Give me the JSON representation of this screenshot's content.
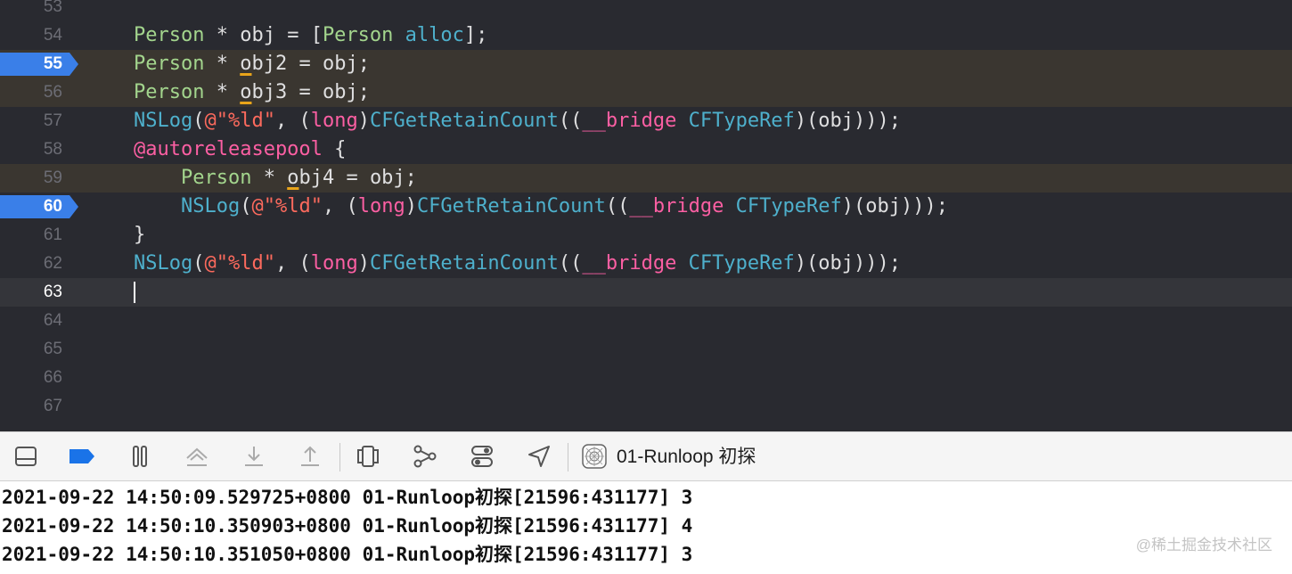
{
  "editor": {
    "lines": [
      {
        "num": "53",
        "tokens": []
      },
      {
        "num": "54",
        "tokens": [
          [
            "t-type",
            "Person"
          ],
          [
            "t-plain",
            " * obj = ["
          ],
          [
            "t-type",
            "Person"
          ],
          [
            "t-plain",
            " "
          ],
          [
            "t-fn",
            "alloc"
          ],
          [
            "t-plain",
            "];"
          ]
        ]
      },
      {
        "num": "55",
        "tokens": [
          [
            "t-type",
            "Person"
          ],
          [
            "t-plain",
            " * "
          ],
          [
            "t-warn",
            "o"
          ],
          [
            "t-plain",
            "bj2 = obj;"
          ]
        ]
      },
      {
        "num": "56",
        "tokens": [
          [
            "t-type",
            "Person"
          ],
          [
            "t-plain",
            " * "
          ],
          [
            "t-warn",
            "o"
          ],
          [
            "t-plain",
            "bj3 = obj;"
          ]
        ]
      },
      {
        "num": "57",
        "tokens": [
          [
            "t-fn",
            "NSLog"
          ],
          [
            "t-plain",
            "("
          ],
          [
            "t-str",
            "@\"%ld\""
          ],
          [
            "t-plain",
            ", ("
          ],
          [
            "t-kw",
            "long"
          ],
          [
            "t-plain",
            ")"
          ],
          [
            "t-fn",
            "CFGetRetainCount"
          ],
          [
            "t-plain",
            "(("
          ],
          [
            "t-kw",
            "__bridge"
          ],
          [
            "t-plain",
            " "
          ],
          [
            "t-fn",
            "CFTypeRef"
          ],
          [
            "t-plain",
            ")(obj)));"
          ]
        ]
      },
      {
        "num": "58",
        "tokens": [
          [
            "t-kw",
            "@autoreleasepool"
          ],
          [
            "t-plain",
            " {"
          ]
        ]
      },
      {
        "num": "59",
        "tokens": [
          [
            "t-plain",
            "    "
          ],
          [
            "t-type",
            "Person"
          ],
          [
            "t-plain",
            " * "
          ],
          [
            "t-warn",
            "o"
          ],
          [
            "t-plain",
            "bj4 = obj;"
          ]
        ]
      },
      {
        "num": "60",
        "tokens": [
          [
            "t-plain",
            "    "
          ],
          [
            "t-fn",
            "NSLog"
          ],
          [
            "t-plain",
            "("
          ],
          [
            "t-str",
            "@\"%ld\""
          ],
          [
            "t-plain",
            ", ("
          ],
          [
            "t-kw",
            "long"
          ],
          [
            "t-plain",
            ")"
          ],
          [
            "t-fn",
            "CFGetRetainCount"
          ],
          [
            "t-plain",
            "(("
          ],
          [
            "t-kw",
            "__bridge"
          ],
          [
            "t-plain",
            " "
          ],
          [
            "t-fn",
            "CFTypeRef"
          ],
          [
            "t-plain",
            ")(obj)));"
          ]
        ]
      },
      {
        "num": "61",
        "tokens": [
          [
            "t-plain",
            "}"
          ]
        ]
      },
      {
        "num": "62",
        "tokens": [
          [
            "t-fn",
            "NSLog"
          ],
          [
            "t-plain",
            "("
          ],
          [
            "t-str",
            "@\"%ld\""
          ],
          [
            "t-plain",
            ", ("
          ],
          [
            "t-kw",
            "long"
          ],
          [
            "t-plain",
            ")"
          ],
          [
            "t-fn",
            "CFGetRetainCount"
          ],
          [
            "t-plain",
            "(("
          ],
          [
            "t-kw",
            "__bridge"
          ],
          [
            "t-plain",
            " "
          ],
          [
            "t-fn",
            "CFTypeRef"
          ],
          [
            "t-plain",
            ")(obj)));"
          ]
        ]
      },
      {
        "num": "63",
        "tokens": []
      },
      {
        "num": "64",
        "tokens": []
      },
      {
        "num": "65",
        "tokens": []
      },
      {
        "num": "66",
        "tokens": []
      },
      {
        "num": "67",
        "tokens": []
      }
    ],
    "breakpoint_lines": [
      "55",
      "60"
    ],
    "warning_lines": [
      "55",
      "56",
      "59"
    ],
    "current_line": "63"
  },
  "debug_bar": {
    "buttons": [
      {
        "name": "hide-debug-area-button",
        "icon": "panel-bottom-icon"
      },
      {
        "name": "breakpoints-toggle-button",
        "icon": "breakpoint-icon"
      },
      {
        "name": "pause-button",
        "icon": "pause-icon"
      },
      {
        "name": "step-over-button",
        "icon": "step-over-icon"
      },
      {
        "name": "step-into-button",
        "icon": "step-into-icon"
      },
      {
        "name": "step-out-button",
        "icon": "step-out-icon"
      },
      {
        "name": "view-hierarchy-button",
        "icon": "view-hierarchy-icon"
      },
      {
        "name": "memory-graph-button",
        "icon": "memory-graph-icon"
      },
      {
        "name": "environment-overrides-button",
        "icon": "toggles-icon"
      },
      {
        "name": "simulate-location-button",
        "icon": "location-arrow-icon"
      }
    ],
    "process_label": "01-Runloop 初探",
    "process_icon": "app-target-icon"
  },
  "console": {
    "lines": [
      "2021-09-22 14:50:09.529725+0800 01-Runloop初探[21596:431177] 3",
      "2021-09-22 14:50:10.350903+0800 01-Runloop初探[21596:431177] 4",
      "2021-09-22 14:50:10.351050+0800 01-Runloop初探[21596:431177] 3"
    ]
  },
  "watermark": "@稀土掘金技术社区",
  "colors": {
    "editor_bg": "#292a30",
    "breakpoint": "#3a7fe8",
    "warning_line": "#3a3630",
    "type": "#a3d58d",
    "function": "#4eb0cc",
    "keyword": "#fc5fa3",
    "string": "#fc6a5d"
  }
}
